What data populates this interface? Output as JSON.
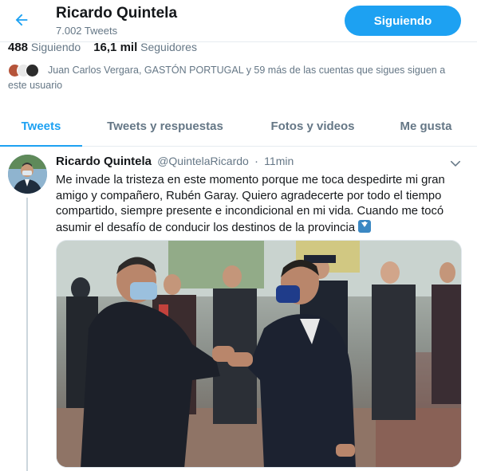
{
  "header": {
    "name": "Ricardo Quintela",
    "tweet_count": "7.002 Tweets",
    "follow_button": "Siguiendo"
  },
  "stats": {
    "following_count": "488",
    "following_label": "Siguiendo",
    "followers_count": "16,1 mil",
    "followers_label": "Seguidores"
  },
  "known_followers": {
    "text_line1": "Juan Carlos Vergara, GASTÓN PORTUGAL y 59 más de las cuentas que sigues siguen a",
    "text_line2": "este usuario"
  },
  "tabs": [
    {
      "label": "Tweets"
    },
    {
      "label": "Tweets y respuestas"
    },
    {
      "label": "Fotos y videos"
    },
    {
      "label": "Me gusta"
    }
  ],
  "tweet": {
    "name": "Ricardo Quintela",
    "handle": "@QuintelaRicardo",
    "separator": "·",
    "time": "11min",
    "text": "Me invade la tristeza en este momento porque me toca despedirte mi gran amigo y compañero, Rubén Garay. Quiero agradecerte por todo el tiempo compartido, siempre presente e incondicional en mi vida. Cuando me tocó asumir el desafío de conducir los destinos de la provincia"
  },
  "colors": {
    "accent": "#1da1f2",
    "secondary_text": "#657786",
    "primary_text": "#14171a"
  },
  "icons": {
    "back": "arrow-left-icon",
    "menu": "chevron-down-icon",
    "emoji": "down-arrow-emoji"
  }
}
